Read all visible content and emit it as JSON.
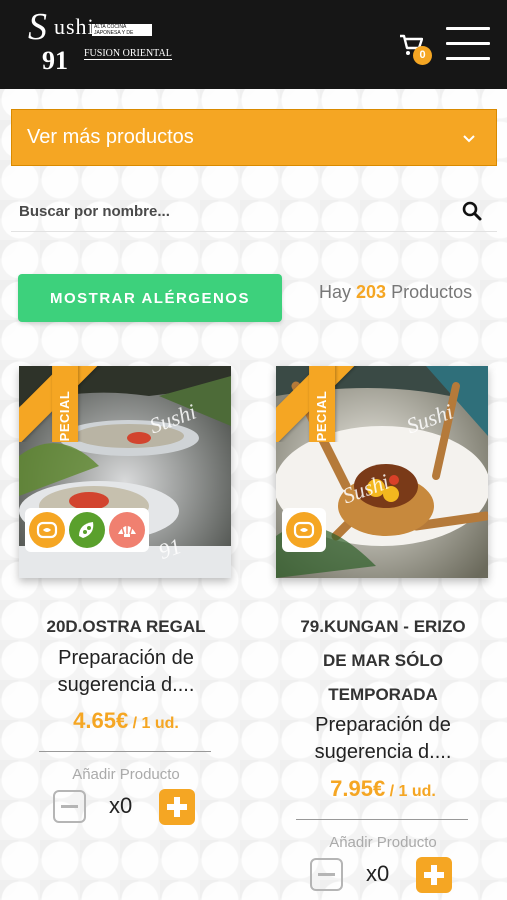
{
  "header": {
    "logo": {
      "s": "S",
      "ushi": "ushi",
      "num": "91",
      "tagline": "ALTA COCINA JAPONESA Y DE FUSION",
      "fusion": "FUSION ORIENTAL"
    },
    "cart_count": "0"
  },
  "more_products": {
    "label": "Ver más productos"
  },
  "search": {
    "placeholder": "Buscar por nombre..."
  },
  "allergens_button": "MOSTRAR ALÉRGENOS",
  "count": {
    "prefix": "Hay",
    "value": "203",
    "suffix": "Productos"
  },
  "products": [
    {
      "ribbon": "ESPECIAL",
      "title_lines": [
        "20D.OSTRA REGAL"
      ],
      "desc_lines": [
        "Preparación de",
        "sugerencia d...."
      ],
      "price": "4.65€",
      "unit": "/ 1 ud.",
      "add_label": "Añadir Producto",
      "qty": "x0",
      "allergens": [
        "fish-icon",
        "soy-icon",
        "shellfish-icon"
      ]
    },
    {
      "ribbon": "ESPECIAL",
      "title_lines": [
        "79.KUNGAN - ERIZO",
        "DE MAR SÓLO",
        "TEMPORADA"
      ],
      "desc_lines": [
        "Preparación de",
        "sugerencia d...."
      ],
      "price": "7.95€",
      "unit": "/ 1 ud.",
      "add_label": "Añadir Producto",
      "qty": "x0",
      "allergens": [
        "fish-icon"
      ]
    }
  ],
  "colors": {
    "accent": "#f5a623",
    "green": "#3dd17c",
    "header": "#161616"
  }
}
